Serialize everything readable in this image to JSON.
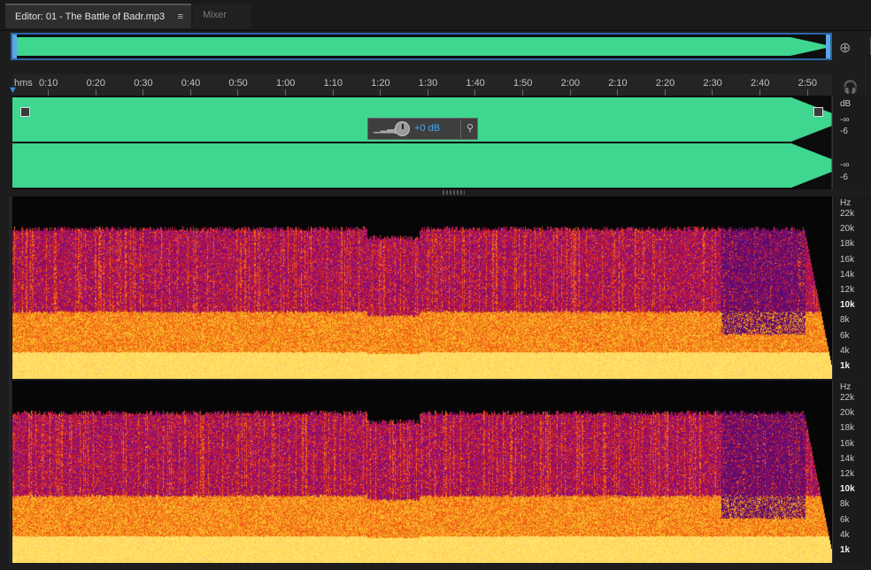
{
  "tabs": {
    "editor_label": "Editor: 01 - The Battle of Badr.mp3",
    "editor_menu": "≡",
    "mixer_label": "Mixer"
  },
  "overview": {
    "zoom_icon": "zoom-to-selection-icon"
  },
  "ruler": {
    "unit": "hms",
    "ticks": [
      "0:10",
      "0:20",
      "0:30",
      "0:40",
      "0:50",
      "1:00",
      "1:10",
      "1:20",
      "1:30",
      "1:40",
      "1:50",
      "2:00",
      "2:10",
      "2:20",
      "2:30",
      "2:40",
      "2:50"
    ]
  },
  "waveform": {
    "color": "#3fd68f",
    "scale": {
      "unit": "dB",
      "top_inf": "-∞",
      "top_minus6": "-6",
      "bot_inf": "-∞",
      "bot_minus6": "-6"
    }
  },
  "hud": {
    "value": "+0 dB"
  },
  "spectral": {
    "unit": "Hz",
    "labels": [
      "22k",
      "20k",
      "18k",
      "16k",
      "14k",
      "12k",
      "10k",
      "8k",
      "6k",
      "4k",
      "1k"
    ],
    "bold_labels": [
      "10k",
      "1k"
    ]
  },
  "colors": {
    "accent": "#2b67a6",
    "wave": "#3fd68f",
    "playhead": "#3c8bd7"
  }
}
